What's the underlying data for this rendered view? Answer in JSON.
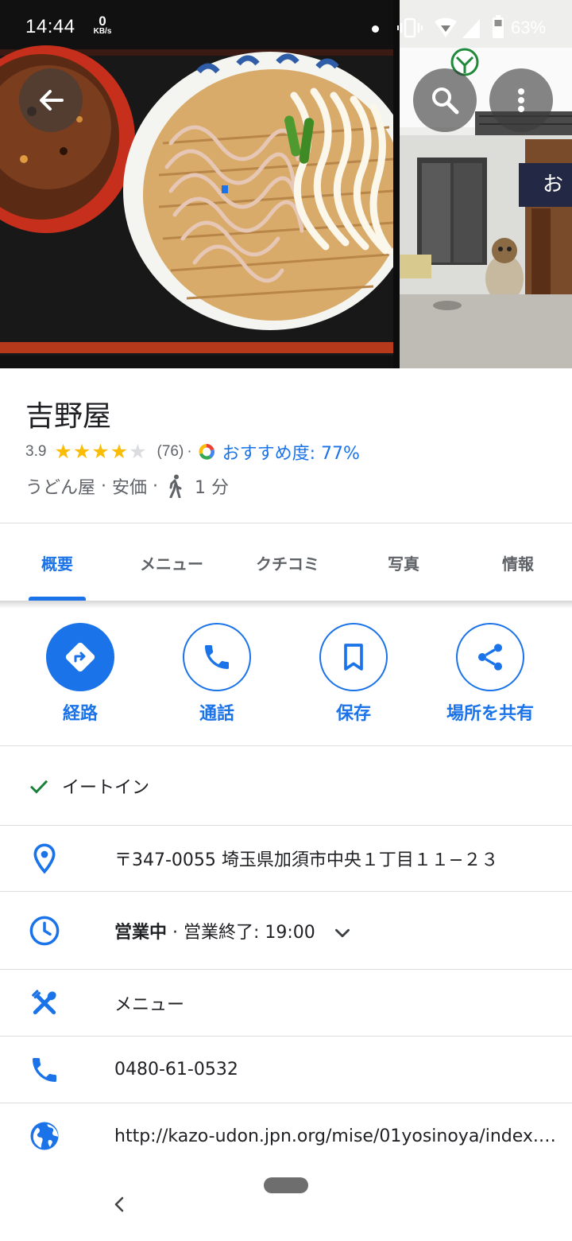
{
  "status_bar": {
    "time": "14:44",
    "net_speed_value": "0",
    "net_speed_unit": "KB/s",
    "battery_percent": "63%"
  },
  "place": {
    "name": "吉野屋",
    "rating": "3.9",
    "rating_value": 3.9,
    "stars_filled": 4,
    "review_count": "(76)",
    "recommend": "おすすめ度: 77%",
    "category": "うどん屋",
    "price": "安価",
    "walk_time": "1 分"
  },
  "tabs": [
    {
      "label": "概要",
      "active": true
    },
    {
      "label": "メニュー",
      "active": false
    },
    {
      "label": "クチコミ",
      "active": false
    },
    {
      "label": "写真",
      "active": false
    },
    {
      "label": "情報",
      "active": false
    }
  ],
  "actions": [
    {
      "label": "経路",
      "icon": "directions-icon"
    },
    {
      "label": "通話",
      "icon": "phone-icon"
    },
    {
      "label": "保存",
      "icon": "bookmark-icon"
    },
    {
      "label": "場所を共有",
      "icon": "share-icon"
    }
  ],
  "info": {
    "dine_in": "イートイン",
    "address": "〒347-0055 埼玉県加須市中央１丁目１１−２３",
    "hours_status": "営業中",
    "hours_close": " · 営業終了: 19:00",
    "menu": "メニュー",
    "phone": "0480-61-0532",
    "website": "http://kazo-udon.jpn.org/mise/01yosinoya/index.…"
  },
  "colors": {
    "accent": "#1a73e8",
    "star": "#fbbc04",
    "check": "#188038",
    "muted_text": "#5f6368"
  }
}
